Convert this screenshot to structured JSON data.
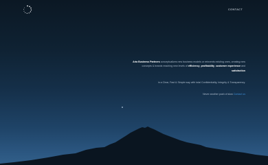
{
  "nav": {
    "contact_label": "CONTACT"
  },
  "intro": {
    "company": "Aria Business Partners",
    "text_before": " conceptualizes new business models or reinvents existing ones, creating new concepts & brands reaching new levels of ",
    "highlight1": "efficiency",
    "sep1": ", ",
    "highlight2": "profitability",
    "sep2": ", ",
    "highlight3": "customer experience",
    "sep3": " and ",
    "highlight4": "satisfaction"
  },
  "tagline": "in a Clear, Fast & Simple way with total Confidentiality, Integrity & Transparency.",
  "cta": {
    "text": "Never another push of slow ",
    "link_label": "Contact us"
  },
  "colors": {
    "accent": "#3e8fd6",
    "sky_top": "#0b1824",
    "sky_bottom": "#32608a",
    "mountain": "#0a1520"
  },
  "icons": {
    "logo": "dotted-ring-logo-icon"
  }
}
